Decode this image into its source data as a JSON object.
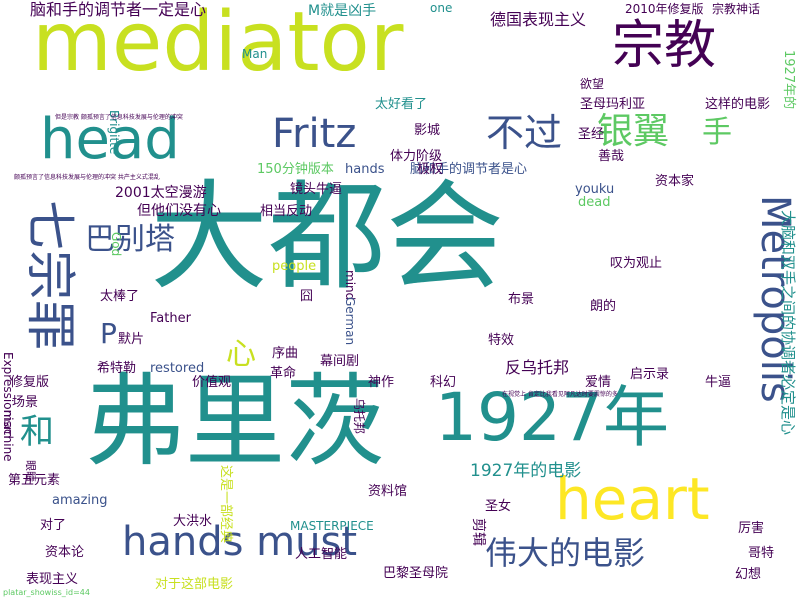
{
  "palette": [
    "#440154",
    "#3b528b",
    "#21908d",
    "#5dc963",
    "#c8e020",
    "#fde725"
  ],
  "words": [
    {
      "text": "大都会",
      "color": "#21908d",
      "weight": 100
    },
    {
      "text": "弗里茨",
      "color": "#21908d",
      "weight": 92
    },
    {
      "text": "mediator",
      "color": "#c8e020",
      "weight": 70
    },
    {
      "text": "1927年",
      "color": "#21908d",
      "weight": 58
    },
    {
      "text": "heart",
      "color": "#fde725",
      "weight": 55
    },
    {
      "text": "宗教",
      "color": "#440154",
      "weight": 52
    },
    {
      "text": "head",
      "color": "#21908d",
      "weight": 48
    },
    {
      "text": "hands must",
      "color": "#3b528b",
      "weight": 40
    },
    {
      "text": "七宗罪",
      "color": "#3b528b",
      "weight": 44
    },
    {
      "text": "Metropolis",
      "color": "#3b528b",
      "weight": 38
    },
    {
      "text": "Fritz",
      "color": "#3b528b",
      "weight": 36
    },
    {
      "text": "不过",
      "color": "#3b528b",
      "weight": 34
    },
    {
      "text": "银翼",
      "color": "#5dc963",
      "weight": 32
    },
    {
      "text": "伟大的电影",
      "color": "#3b528b",
      "weight": 30
    },
    {
      "text": "巴别塔",
      "color": "#3b528b",
      "weight": 28
    },
    {
      "text": "手",
      "color": "#5dc963",
      "weight": 30
    },
    {
      "text": "和",
      "color": "#21908d",
      "weight": 30
    },
    {
      "text": "心",
      "color": "#c8e020",
      "weight": 30
    },
    {
      "text": "P",
      "color": "#3b528b",
      "weight": 28
    },
    {
      "text": "1927年的电影",
      "color": "#21908d",
      "weight": 20
    },
    {
      "text": "大脑和双手之间的协调者必定是心",
      "color": "#21908d",
      "weight": 14
    },
    {
      "text": "脑和手的调节者一定是心",
      "color": "#440154",
      "weight": 12
    },
    {
      "text": "德国表现主义",
      "color": "#440154",
      "weight": 12
    },
    {
      "text": "2010年修复版",
      "color": "#440154",
      "weight": 10
    },
    {
      "text": "宗教神话",
      "color": "#440154",
      "weight": 10
    },
    {
      "text": "M就是凶手",
      "color": "#21908d",
      "weight": 10
    },
    {
      "text": "圣母玛利亚",
      "color": "#440154",
      "weight": 10
    },
    {
      "text": "这样的电影",
      "color": "#440154",
      "weight": 10
    },
    {
      "text": "太好看了",
      "color": "#21908d",
      "weight": 10
    },
    {
      "text": "圣经",
      "color": "#440154",
      "weight": 10
    },
    {
      "text": "影城",
      "color": "#440154",
      "weight": 10
    },
    {
      "text": "体力阶级",
      "color": "#440154",
      "weight": 10
    },
    {
      "text": "脑和手的调节者是心",
      "color": "#3b528b",
      "weight": 10
    },
    {
      "text": "善哉",
      "color": "#440154",
      "weight": 10
    },
    {
      "text": "150分钟版本",
      "color": "#5dc963",
      "weight": 10
    },
    {
      "text": "hands",
      "color": "#3b528b",
      "weight": 10
    },
    {
      "text": "极权",
      "color": "#440154",
      "weight": 10
    },
    {
      "text": "镜头牛逼",
      "color": "#440154",
      "weight": 10
    },
    {
      "text": "youku",
      "color": "#3b528b",
      "weight": 10
    },
    {
      "text": "资本家",
      "color": "#440154",
      "weight": 10
    },
    {
      "text": "2001太空漫游",
      "color": "#440154",
      "weight": 12
    },
    {
      "text": "但他们没有心",
      "color": "#440154",
      "weight": 12
    },
    {
      "text": "dead",
      "color": "#5dc963",
      "weight": 10
    },
    {
      "text": "相当反动",
      "color": "#440154",
      "weight": 10
    },
    {
      "text": "God",
      "color": "#5dc963",
      "weight": 8
    },
    {
      "text": "mind",
      "color": "#440154",
      "weight": 8
    },
    {
      "text": "叹为观止",
      "color": "#440154",
      "weight": 10
    },
    {
      "text": "people",
      "color": "#c8e020",
      "weight": 10
    },
    {
      "text": "囧",
      "color": "#440154",
      "weight": 10
    },
    {
      "text": "布景",
      "color": "#440154",
      "weight": 10
    },
    {
      "text": "太棒了",
      "color": "#440154",
      "weight": 10
    },
    {
      "text": "Father",
      "color": "#440154",
      "weight": 10
    },
    {
      "text": "German",
      "color": "#3b528b",
      "weight": 10
    },
    {
      "text": "朗的",
      "color": "#440154",
      "weight": 10
    },
    {
      "text": "默片",
      "color": "#440154",
      "weight": 10
    },
    {
      "text": "序曲",
      "color": "#440154",
      "weight": 10
    },
    {
      "text": "特效",
      "color": "#440154",
      "weight": 10
    },
    {
      "text": "幕间剧",
      "color": "#440154",
      "weight": 10
    },
    {
      "text": "希特勒",
      "color": "#440154",
      "weight": 10
    },
    {
      "text": "restored",
      "color": "#3b528b",
      "weight": 10
    },
    {
      "text": "革命",
      "color": "#440154",
      "weight": 10
    },
    {
      "text": "反乌托邦",
      "color": "#440154",
      "weight": 12
    },
    {
      "text": "修复版",
      "color": "#440154",
      "weight": 10
    },
    {
      "text": "价值观",
      "color": "#440154",
      "weight": 10
    },
    {
      "text": "爱情",
      "color": "#440154",
      "weight": 10
    },
    {
      "text": "启示录",
      "color": "#440154",
      "weight": 10
    },
    {
      "text": "场景",
      "color": "#440154",
      "weight": 10
    },
    {
      "text": "神作",
      "color": "#440154",
      "weight": 10
    },
    {
      "text": "科幻",
      "color": "#440154",
      "weight": 10
    },
    {
      "text": "牛逼",
      "color": "#440154",
      "weight": 10
    },
    {
      "text": "第五元素",
      "color": "#440154",
      "weight": 10
    },
    {
      "text": "乌托邦",
      "color": "#440154",
      "weight": 10
    },
    {
      "text": "资料馆",
      "color": "#440154",
      "weight": 10
    },
    {
      "text": "amazing",
      "color": "#3b528b",
      "weight": 10
    },
    {
      "text": "MASTERPIECE",
      "color": "#21908d",
      "weight": 10
    },
    {
      "text": "大洪水",
      "color": "#440154",
      "weight": 10
    },
    {
      "text": "对了",
      "color": "#440154",
      "weight": 10
    },
    {
      "text": "资本论",
      "color": "#440154",
      "weight": 10
    },
    {
      "text": "表现主义",
      "color": "#440154",
      "weight": 10
    },
    {
      "text": "人工智能",
      "color": "#440154",
      "weight": 10
    },
    {
      "text": "巴黎圣母院",
      "color": "#440154",
      "weight": 10
    },
    {
      "text": "对于这部电影",
      "color": "#c8e020",
      "weight": 10
    },
    {
      "text": "圣女",
      "color": "#440154",
      "weight": 10
    },
    {
      "text": "剪辑",
      "color": "#440154",
      "weight": 10
    },
    {
      "text": "哥特",
      "color": "#440154",
      "weight": 10
    },
    {
      "text": "厉害",
      "color": "#440154",
      "weight": 10
    },
    {
      "text": "幻想",
      "color": "#440154",
      "weight": 10
    },
    {
      "text": "Expressionism",
      "color": "#440154",
      "weight": 10
    },
    {
      "text": "machine",
      "color": "#440154",
      "weight": 10
    },
    {
      "text": "Brigitte",
      "color": "#21908d",
      "weight": 10
    },
    {
      "text": "Man",
      "color": "#21908d",
      "weight": 10
    },
    {
      "text": "one",
      "color": "#21908d",
      "weight": 10
    },
    {
      "text": "欲望",
      "color": "#440154",
      "weight": 10
    },
    {
      "text": "1927年的",
      "color": "#5dc963",
      "weight": 10
    },
    {
      "text": "这是一部经典",
      "color": "#c8e020",
      "weight": 10
    },
    {
      "text": "眼睛",
      "color": "#440154",
      "weight": 8
    },
    {
      "text": "在视觉上 肯定比我看见阿凡达时要震惊的多",
      "color": "#440154",
      "weight": 6
    },
    {
      "text": "但是宗教 颇孤预言了信息科技发展与伦理的冲突",
      "color": "#440154",
      "weight": 5
    },
    {
      "text": "颇孤预言了信息科技发展与伦理的冲突 共产主义式混乱",
      "color": "#440154",
      "weight": 5
    },
    {
      "text": "platar_showiss_id=44",
      "color": "#5dc963",
      "weight": 5
    }
  ]
}
